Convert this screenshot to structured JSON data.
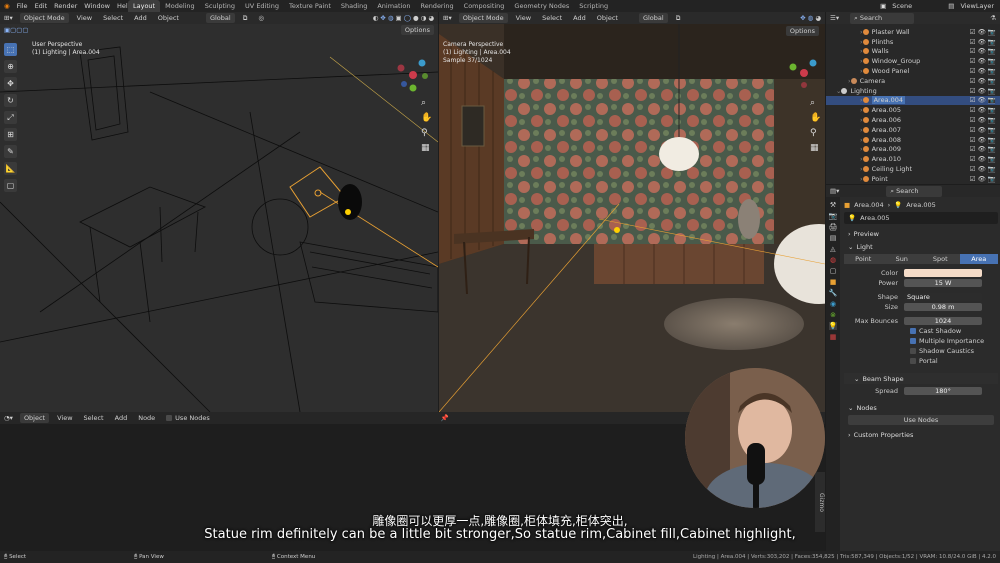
{
  "topbar": {
    "menus": [
      "File",
      "Edit",
      "Render",
      "Window",
      "Help"
    ],
    "workspaces": [
      "Layout",
      "Modeling",
      "Sculpting",
      "UV Editing",
      "Texture Paint",
      "Shading",
      "Animation",
      "Rendering",
      "Compositing",
      "Geometry Nodes",
      "Scripting"
    ],
    "active_workspace": "Layout",
    "scene": "Scene",
    "view_layer": "ViewLayer"
  },
  "viewport_left": {
    "mode": "Object Mode",
    "menu": [
      "View",
      "Select",
      "Add",
      "Object"
    ],
    "orientation": "Global",
    "options": "Options",
    "title": "User Perspective",
    "subtitle": "(1) Lighting | Area.004"
  },
  "viewport_right": {
    "mode": "Object Mode",
    "menu": [
      "View",
      "Select",
      "Add",
      "Object"
    ],
    "orientation": "Global",
    "options": "Options",
    "title": "Camera Perspective",
    "subtitle": "(1) Lighting | Area.004",
    "sample": "Sample 37/1024"
  },
  "node_editor": {
    "type": "Object",
    "menu": [
      "View",
      "Select",
      "Add",
      "Node"
    ],
    "use_nodes": "Use Nodes",
    "sidebar_tab": "Gizmo"
  },
  "outliner": {
    "search_placeholder": "Search",
    "rows": [
      {
        "label": "Plaster Wall",
        "color": "#e08a3c"
      },
      {
        "label": "Plinths",
        "color": "#e08a3c"
      },
      {
        "label": "Walls",
        "color": "#e08a3c"
      },
      {
        "label": "Window_Group",
        "color": "#e08a3c"
      },
      {
        "label": "Wood Panel",
        "color": "#e08a3c"
      },
      {
        "label": "Camera",
        "color": "#c98a5a"
      },
      {
        "label": "Lighting",
        "color": "#cccccc"
      },
      {
        "label": "Area.004",
        "color": "#e08a3c",
        "selected": true
      },
      {
        "label": "Area.005",
        "color": "#e08a3c"
      },
      {
        "label": "Area.006",
        "color": "#e08a3c"
      },
      {
        "label": "Area.007",
        "color": "#e08a3c"
      },
      {
        "label": "Area.008",
        "color": "#e08a3c"
      },
      {
        "label": "Area.009",
        "color": "#e08a3c"
      },
      {
        "label": "Area.010",
        "color": "#e08a3c"
      },
      {
        "label": "Ceiling Light",
        "color": "#e08a3c"
      },
      {
        "label": "Point",
        "color": "#e08a3c"
      }
    ]
  },
  "properties": {
    "search_placeholder": "Search",
    "breadcrumb": [
      "Area.004",
      "Area.005"
    ],
    "data_name": "Area.005",
    "preview": "Preview",
    "light": "Light",
    "light_types": [
      "Point",
      "Sun",
      "Spot",
      "Area"
    ],
    "active_type": "Area",
    "fields": [
      {
        "label": "Color",
        "value": ""
      },
      {
        "label": "Power",
        "value": "15 W"
      },
      {
        "label": "Shape",
        "value": "Square"
      },
      {
        "label": "Size",
        "value": "0.98 m"
      },
      {
        "label": "Max Bounces",
        "value": "1024"
      }
    ],
    "checks": [
      {
        "label": "Cast Shadow",
        "on": true
      },
      {
        "label": "Multiple Importance",
        "on": true
      },
      {
        "label": "Shadow Caustics",
        "on": false
      },
      {
        "label": "Portal",
        "on": false
      }
    ],
    "beam_shape": "Beam Shape",
    "spread_label": "Spread",
    "spread": "180°",
    "nodes": "Nodes",
    "use_nodes": "Use Nodes",
    "custom_properties": "Custom Properties"
  },
  "subtitles": {
    "line1": "雕像圈可以更厚一点,雕像圈,柜体填充,柜体突出,",
    "line2": "Statue rim definitely can be a little bit stronger,So statue rim,Cabinet fill,Cabinet highlight,"
  },
  "statusbar": {
    "left": [
      "Select",
      "Pan View",
      "Context Menu"
    ],
    "right": "Lighting | Area.004 | Verts:303,202 | Faces:354,825 | Tris:587,349 | Objects:1/52 | VRAM: 10.8/24.0 GiB | 4.2.0"
  },
  "colors": {
    "accent": "#4772b3",
    "light_color": "#f5dcc8",
    "selection": "#e8a033"
  }
}
